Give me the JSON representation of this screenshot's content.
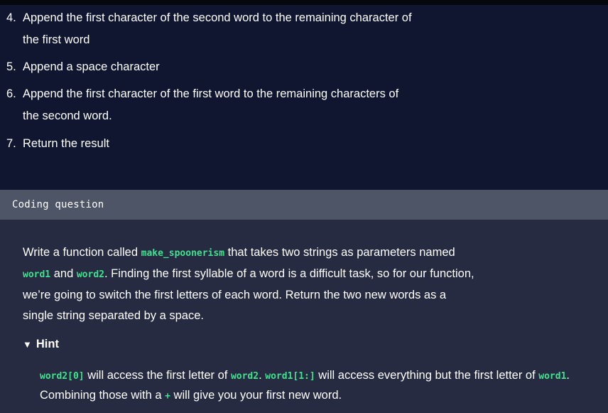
{
  "steps": [
    {
      "num": "4.",
      "line1": "Append the first character of the second word to the remaining character of",
      "line2": "the first word"
    },
    {
      "num": "5.",
      "line1": "Append a space character"
    },
    {
      "num": "6.",
      "line1": "Append the first character of the first word to the remaining characters of",
      "line2": "the second word."
    },
    {
      "num": "7.",
      "line1": "Return the result"
    }
  ],
  "coding_question": {
    "header": "Coding question",
    "q_part1": "Write a function called ",
    "q_code1": "make_spoonerism",
    "q_part2": " that takes two strings as parameters named ",
    "q_code2": "word1",
    "q_part3": " and ",
    "q_code3": "word2",
    "q_part4": ". Finding the first syllable of a word is a difficult task, so for our function, we’re going to switch the first letters of each word. Return the two new words as a single string separated by a space.",
    "hint_label": "Hint",
    "hint_arrow": "▼",
    "hint": {
      "code1": "word2[0]",
      "t1": " will access the first letter of ",
      "code2": "word2",
      "t2": ". ",
      "code3": "word1[1:]",
      "t3": " will access everything but the first letter of ",
      "code4": "word1",
      "t4": ". Combining those with a ",
      "code5": "+",
      "t5": " will give you your first new word."
    }
  },
  "colors": {
    "accent_code": "#3fe28e",
    "bg": "#10162f",
    "panel": "#262b41",
    "header": "#4e5567"
  }
}
